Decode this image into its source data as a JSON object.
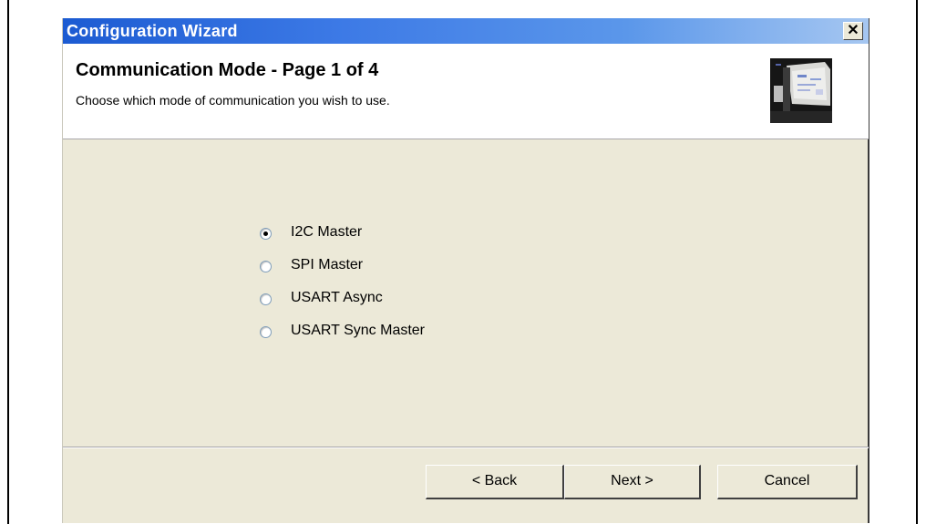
{
  "window": {
    "title": "Configuration Wizard",
    "close_glyph": "✕"
  },
  "header": {
    "title": "Communication Mode  -  Page 1 of 4",
    "subtitle": "Choose which mode of communication you wish to use.",
    "image_icon": "wizard-banner-image"
  },
  "options": [
    {
      "label": "I2C Master",
      "checked": true
    },
    {
      "label": "SPI Master",
      "checked": false
    },
    {
      "label": "USART Async",
      "checked": false
    },
    {
      "label": "USART Sync Master",
      "checked": false
    }
  ],
  "buttons": {
    "back": "< Back",
    "next": "Next >",
    "cancel": "Cancel"
  }
}
